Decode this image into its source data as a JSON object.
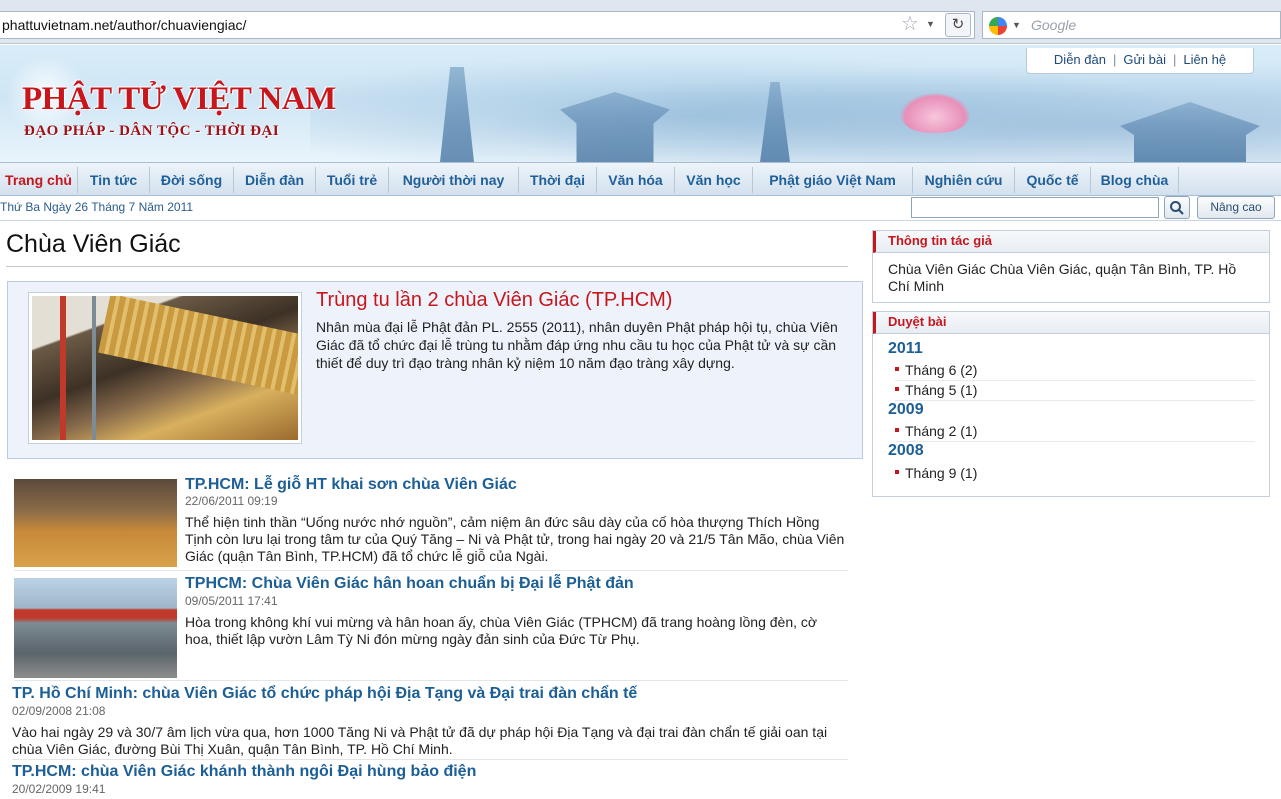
{
  "browser": {
    "url": "phattuvietnam.net/author/chuaviengiac/",
    "search_placeholder": "Google"
  },
  "header": {
    "site_title": "PHẬT TỬ VIỆT NAM",
    "slogan": "ĐẠO PHÁP - DÂN TỘC - THỜI ĐẠI",
    "links": [
      "Diễn đàn",
      "Gửi bài",
      "Liên hệ"
    ]
  },
  "nav": {
    "items": [
      "Trang chủ",
      "Tin tức",
      "Đời sống",
      "Diễn đàn",
      "Tuổi trẻ",
      "Người thời nay",
      "Thời đại",
      "Văn hóa",
      "Văn học",
      "Phật giáo Việt Nam",
      "Nghiên cứu",
      "Quốc tế",
      "Blog chùa"
    ],
    "active": "Trang chủ"
  },
  "datebar": {
    "date": "Thứ Ba Ngày 26 Tháng 7 Năm 2011",
    "search_value": "",
    "advanced_label": "Nâng cao"
  },
  "main": {
    "page_title": "Chùa Viên Giác",
    "featured": {
      "title": "Trùng tu lần 2 chùa Viên Giác (TP.HCM)",
      "description": "Nhân mùa đại lễ Phật đản PL. 2555 (2011), nhân duyên Phật pháp hội tụ, chùa Viên Giác đã tổ chức đại lễ trùng tu nhằm đáp ứng nhu cầu tu học của Phật tử và sự cần thiết để duy trì đạo tràng nhân kỷ niệm 10 năm đạo tràng xây dựng."
    },
    "articles": [
      {
        "title": "TP.HCM: Lễ giỗ HT khai sơn chùa Viên Giác",
        "date": "22/06/2011 09:19",
        "description": "Thể hiện tinh thần “Uống nước nhớ nguồn”, cảm niệm ân đức sâu dày của cố hòa thượng Thích Hồng Tịnh còn lưu lại trong tâm tư của Quý Tăng – Ni và Phật tử, trong hai ngày 20 và 21/5 Tân Mão, chùa Viên Giác (quận Tân Bình, TP.HCM) đã tổ chức lễ giỗ của Ngài."
      },
      {
        "title": "TPHCM: Chùa Viên Giác hân hoan chuẩn bị Đại lễ Phật đản",
        "date": "09/05/2011 17:41",
        "description": "Hòa trong không khí vui mừng và hân hoan ấy, chùa Viên Giác (TPHCM) đã trang hoàng lồng đèn, cờ hoa, thiết lập vườn Lâm Tỳ Ni đón mừng ngày đản sinh của Đức Từ Phụ."
      },
      {
        "title": "TP. Hồ Chí Minh: chùa Viên Giác tổ chức pháp hội Địa Tạng và Đại trai đàn chẩn tế",
        "date": "02/09/2008 21:08",
        "description": "Vào hai ngày 29 và 30/7 âm lịch vừa qua, hơn 1000 Tăng Ni và Phật tử đã dự pháp hội Địa Tạng và đại trai đàn chẩn tế giải oan tại chùa Viên Giác, đường Bùi Thị Xuân, quận Tân Bình, TP. Hồ Chí Minh."
      },
      {
        "title": "TP.HCM: chùa Viên Giác khánh thành ngôi Đại hùng bảo điện",
        "date": "20/02/2009 19:41"
      }
    ]
  },
  "sidebar": {
    "author_heading": "Thông tin tác giả",
    "author_text": "Chùa Viên Giác Chùa Viên Giác, quận Tân Bình, TP. Hồ Chí Minh",
    "archive_heading": "Duyệt bài",
    "archive": [
      {
        "year": "2011",
        "months": [
          "Tháng 6 (2)",
          "Tháng 5 (1)"
        ]
      },
      {
        "year": "2009",
        "months": [
          "Tháng 2 (1)"
        ]
      },
      {
        "year": "2008",
        "months": [
          "Tháng 9 (1)"
        ]
      }
    ]
  },
  "colors": {
    "brand_red": "#c8161d",
    "link_blue": "#1c5e96"
  }
}
